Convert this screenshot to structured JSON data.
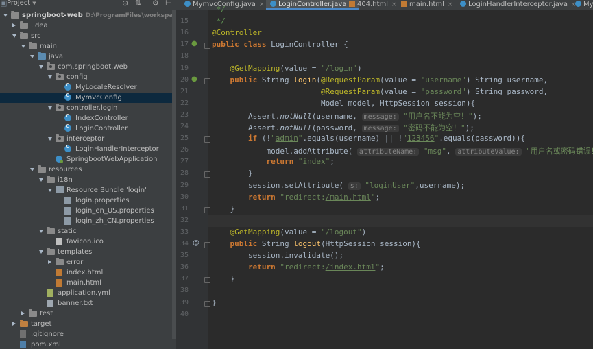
{
  "project_panel": {
    "title": "Project",
    "tree": [
      {
        "label": "springboot-web",
        "sub": "D:\\ProgramFiles\\workspace\\mysel",
        "depth": 0,
        "arrow": "down",
        "icon": "folder",
        "bold": true,
        "name": "tree-item-springboot-web"
      },
      {
        "label": ".idea",
        "depth": 1,
        "arrow": "right",
        "icon": "folder",
        "name": "tree-item-idea"
      },
      {
        "label": "src",
        "depth": 1,
        "arrow": "down",
        "icon": "folder",
        "name": "tree-item-src"
      },
      {
        "label": "main",
        "depth": 2,
        "arrow": "down",
        "icon": "folder",
        "name": "tree-item-main"
      },
      {
        "label": "java",
        "depth": 3,
        "arrow": "down",
        "icon": "folder src",
        "name": "tree-item-java"
      },
      {
        "label": "com.springboot.web",
        "depth": 4,
        "arrow": "down",
        "icon": "folder pkg",
        "name": "tree-item-com-springboot-web"
      },
      {
        "label": "config",
        "depth": 5,
        "arrow": "down",
        "icon": "folder pkg",
        "name": "tree-item-config"
      },
      {
        "label": "MyLocaleResolver",
        "depth": 6,
        "arrow": "",
        "icon": "cls",
        "name": "tree-item-mylocaleresolver"
      },
      {
        "label": "MymvcConfig",
        "depth": 6,
        "arrow": "",
        "icon": "cls",
        "selected": true,
        "name": "tree-item-mymvcconfig"
      },
      {
        "label": "controller.login",
        "depth": 5,
        "arrow": "down",
        "icon": "folder pkg",
        "name": "tree-item-controller-login"
      },
      {
        "label": "IndexController",
        "depth": 6,
        "arrow": "",
        "icon": "cls",
        "name": "tree-item-indexcontroller"
      },
      {
        "label": "LoginController",
        "depth": 6,
        "arrow": "",
        "icon": "cls",
        "name": "tree-item-logincontroller"
      },
      {
        "label": "interceptor",
        "depth": 5,
        "arrow": "down",
        "icon": "folder pkg",
        "name": "tree-item-interceptor"
      },
      {
        "label": "LoginHandlerInterceptor",
        "depth": 6,
        "arrow": "",
        "icon": "cls",
        "name": "tree-item-loginhandlerinterceptor"
      },
      {
        "label": "SpringbootWebApplication",
        "depth": 5,
        "arrow": "",
        "icon": "boot",
        "name": "tree-item-springbootwebapplication"
      },
      {
        "label": "resources",
        "depth": 3,
        "arrow": "down",
        "icon": "folder res",
        "name": "tree-item-resources"
      },
      {
        "label": "i18n",
        "depth": 4,
        "arrow": "down",
        "icon": "folder",
        "name": "tree-item-i18n"
      },
      {
        "label": "Resource Bundle 'login'",
        "depth": 5,
        "arrow": "down",
        "icon": "bundle",
        "name": "tree-item-resource-bundle-login"
      },
      {
        "label": "login.properties",
        "depth": 6,
        "arrow": "",
        "icon": "file prop",
        "name": "tree-item-login-properties"
      },
      {
        "label": "login_en_US.properties",
        "depth": 6,
        "arrow": "",
        "icon": "file prop",
        "name": "tree-item-login-en-us-properties"
      },
      {
        "label": "login_zh_CN.properties",
        "depth": 6,
        "arrow": "",
        "icon": "file prop",
        "name": "tree-item-login-zh-cn-properties"
      },
      {
        "label": "static",
        "depth": 4,
        "arrow": "down",
        "icon": "folder",
        "name": "tree-item-static"
      },
      {
        "label": "favicon.ico",
        "depth": 5,
        "arrow": "",
        "icon": "file img",
        "name": "tree-item-favicon"
      },
      {
        "label": "templates",
        "depth": 4,
        "arrow": "down",
        "icon": "folder",
        "name": "tree-item-templates"
      },
      {
        "label": "error",
        "depth": 5,
        "arrow": "right",
        "icon": "folder",
        "name": "tree-item-error"
      },
      {
        "label": "index.html",
        "depth": 5,
        "arrow": "",
        "icon": "file html",
        "name": "tree-item-index-html"
      },
      {
        "label": "main.html",
        "depth": 5,
        "arrow": "",
        "icon": "file html",
        "name": "tree-item-main-html"
      },
      {
        "label": "application.yml",
        "depth": 4,
        "arrow": "",
        "icon": "file yml",
        "name": "tree-item-application-yml"
      },
      {
        "label": "banner.txt",
        "depth": 4,
        "arrow": "",
        "icon": "file txt",
        "name": "tree-item-banner-txt"
      },
      {
        "label": "test",
        "depth": 2,
        "arrow": "right",
        "icon": "folder",
        "name": "tree-item-test"
      },
      {
        "label": "target",
        "depth": 1,
        "arrow": "right",
        "icon": "folder tgt",
        "name": "tree-item-target"
      },
      {
        "label": ".gitignore",
        "depth": 1,
        "arrow": "",
        "icon": "file git",
        "name": "tree-item-gitignore"
      },
      {
        "label": "pom.xml",
        "depth": 1,
        "arrow": "",
        "icon": "file xml",
        "name": "tree-item-pom-xml"
      }
    ]
  },
  "tabs": [
    {
      "label": "MymvcConfig.java",
      "icon": "class-icon",
      "active": false
    },
    {
      "label": "LoginController.java",
      "icon": "class-icon",
      "active": true
    },
    {
      "label": "404.html",
      "icon": "html-icon",
      "active": false
    },
    {
      "label": "main.html",
      "icon": "html-icon",
      "active": false
    },
    {
      "label": "LoginHandlerInterceptor.java",
      "icon": "class-icon",
      "active": false
    },
    {
      "label": "My",
      "icon": "class-icon",
      "active": false
    }
  ],
  "editor": {
    "current_line": 32,
    "lines": [
      {
        "n": "",
        "html": "<span class=\"cm\"> */</span>"
      },
      {
        "n": 15,
        "html": "<span class=\"cm\"> */</span>"
      },
      {
        "n": 16,
        "html": "<span class=\"an\">@Controller</span>"
      },
      {
        "n": 17,
        "html": "<span class=\"kw\">public class</span> LoginController {"
      },
      {
        "n": 18,
        "html": ""
      },
      {
        "n": 19,
        "html": "    <span class=\"an\">@GetMapping</span>(value = <span class=\"st\">\"/login\"</span>)"
      },
      {
        "n": 20,
        "html": "    <span class=\"kw\">public</span> String <span style=\"color:#ffc66d\">login</span>(<span class=\"an\">@RequestParam</span>(value = <span class=\"st\">\"username\"</span>) String username,"
      },
      {
        "n": 21,
        "html": "                        <span class=\"an\">@RequestParam</span>(value = <span class=\"st\">\"password\"</span>) String password,"
      },
      {
        "n": 22,
        "html": "                        Model model, HttpSession session){"
      },
      {
        "n": 23,
        "html": "        Assert.<span class=\"it\">notNull</span>(username, <span class=\"hint\">message:</span> <span class=\"st\">\"用户名不能为空！\"</span>);"
      },
      {
        "n": 24,
        "html": "        Assert.<span class=\"it\">notNull</span>(password, <span class=\"hint\">message:</span> <span class=\"st\">\"密码不能为空！\"</span>);"
      },
      {
        "n": 25,
        "html": "        <span class=\"kw\">if</span> (!<span class=\"st\">\"<span class=\"ulin\">admin</span>\"</span>.equals(username) || !<span class=\"st\">\"<span class=\"ulin\">123456</span>\"</span>.equals(password)){"
      },
      {
        "n": 26,
        "html": "            model.addAttribute( <span class=\"hint\">attributeName:</span> <span class=\"st\">\"msg\"</span>, <span class=\"hint\">attributeValue:</span> <span class=\"st\">\"用户名或密码错误！\"</span>);"
      },
      {
        "n": 27,
        "html": "            <span class=\"kw\">return</span> <span class=\"st\">\"index\"</span>;"
      },
      {
        "n": 28,
        "html": "        }"
      },
      {
        "n": 29,
        "html": "        session.setAttribute( <span class=\"hint\">s:</span> <span class=\"st\">\"loginUser\"</span>,username);"
      },
      {
        "n": 30,
        "html": "        <span class=\"kw\">return</span> <span class=\"st\">\"redirect:<span class=\"ulin\">/main.html</span>\"</span>;"
      },
      {
        "n": 31,
        "html": "    }"
      },
      {
        "n": 32,
        "html": ""
      },
      {
        "n": 33,
        "html": "    <span class=\"an\">@GetMapping</span>(value = <span class=\"st\">\"/logout\"</span>)"
      },
      {
        "n": 34,
        "html": "    <span class=\"kw\">public</span> String <span style=\"color:#ffc66d\">logout</span>(HttpSession session){"
      },
      {
        "n": 35,
        "html": "        session.invalidate();"
      },
      {
        "n": 36,
        "html": "        <span class=\"kw\">return</span> <span class=\"st\">\"redirect:<span class=\"ulin\">/index.html</span>\"</span>;"
      },
      {
        "n": 37,
        "html": "    }"
      },
      {
        "n": 38,
        "html": ""
      },
      {
        "n": 39,
        "html": "}"
      },
      {
        "n": 40,
        "html": ""
      }
    ]
  },
  "colors": {
    "keyword": "#cc7832",
    "annotation": "#bbb529",
    "string": "#6a8759",
    "text": "#a9b7c6",
    "selection": "#0d293e"
  }
}
